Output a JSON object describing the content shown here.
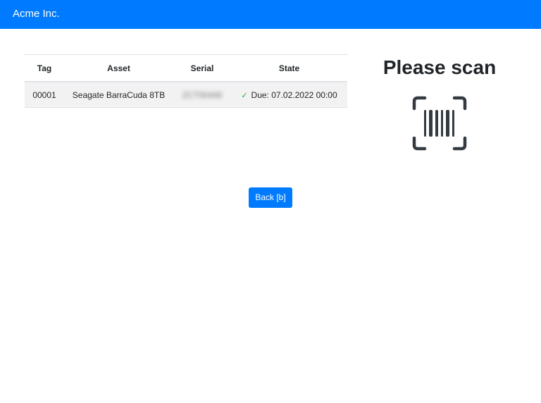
{
  "navbar": {
    "brand": "Acme Inc."
  },
  "table": {
    "headers": [
      "Tag",
      "Asset",
      "Serial",
      "State"
    ],
    "rows": [
      {
        "tag": "00001",
        "asset": "Seagate BarraCuda 8TB",
        "serial": "ZCT00446",
        "state": "Due: 07.02.2022 00:00",
        "state_icon": "check-icon"
      }
    ]
  },
  "scan": {
    "title": "Please scan",
    "icon": "barcode-scan-icon"
  },
  "actions": {
    "back_label": "Back [b]"
  },
  "colors": {
    "primary": "#007bff",
    "success": "#28a745",
    "row_stripe": "#f2f2f2"
  }
}
